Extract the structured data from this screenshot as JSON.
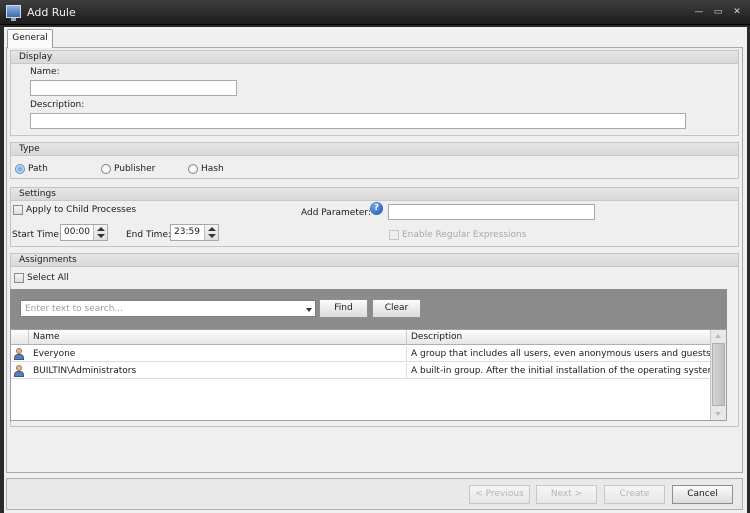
{
  "window": {
    "title": "Add Rule"
  },
  "tabs": [
    {
      "label": "General"
    }
  ],
  "display": {
    "header": "Display",
    "name_label": "Name:",
    "name_value": "",
    "description_label": "Description:",
    "description_value": ""
  },
  "type": {
    "header": "Type",
    "options": [
      {
        "label": "Path",
        "selected": true
      },
      {
        "label": "Publisher",
        "selected": false
      },
      {
        "label": "Hash",
        "selected": false
      }
    ]
  },
  "settings": {
    "header": "Settings",
    "apply_child_label": "Apply to Child Processes",
    "add_parameter_label": "Add Parameter:",
    "add_parameter_value": "",
    "start_time_label": "Start Time:",
    "start_time_value": "00:00",
    "end_time_label": "End Time:",
    "end_time_value": "23:59",
    "regex_label": "Enable Regular Expressions"
  },
  "assignments": {
    "header": "Assignments",
    "select_all_label": "Select All",
    "search_placeholder": "Enter text to search...",
    "find_label": "Find",
    "clear_label": "Clear",
    "columns": [
      "Name",
      "Description"
    ],
    "rows": [
      {
        "name": "Everyone",
        "description": "A group that includes all users, even anonymous users and guests. Memb..."
      },
      {
        "name": "BUILTIN\\Administrators",
        "description": "A built-in group. After the initial installation of the operating system, the ..."
      }
    ]
  },
  "footer": {
    "previous_label": "< Previous",
    "next_label": "Next >",
    "create_label": "Create",
    "cancel_label": "Cancel"
  }
}
